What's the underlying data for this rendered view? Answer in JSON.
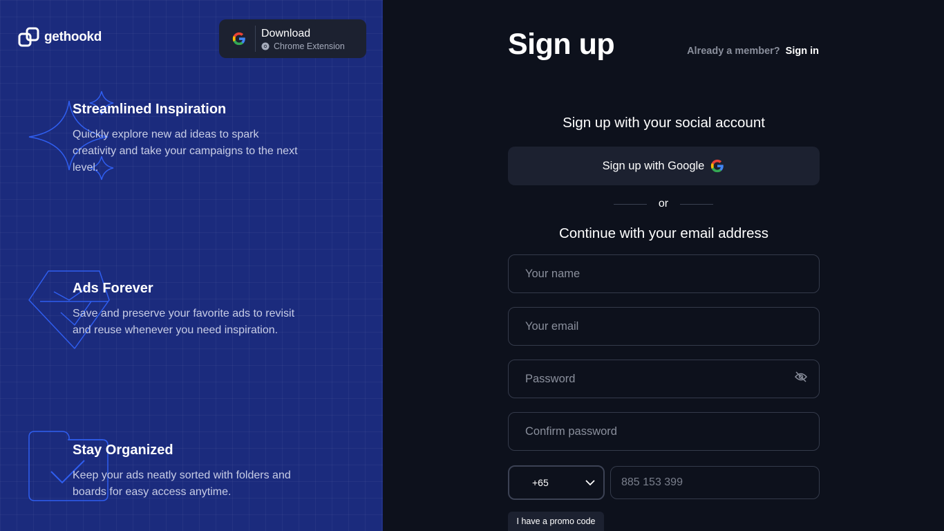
{
  "brand": {
    "name": "gethookd"
  },
  "download": {
    "title": "Download",
    "subtitle": "Chrome Extension"
  },
  "features": [
    {
      "title": "Streamlined Inspiration",
      "text": "Quickly explore new ad ideas to spark creativity and take your campaigns to the next level.",
      "icon": "sparkle-icon"
    },
    {
      "title": "Ads Forever",
      "text": "Save and preserve your favorite ads to revisit and reuse whenever you need inspiration.",
      "icon": "bookmark-badge-icon"
    },
    {
      "title": "Stay Organized",
      "text": "Keep your ads neatly sorted with folders and boards for easy access anytime.",
      "icon": "folder-check-icon"
    }
  ],
  "signup": {
    "title": "Sign up",
    "member_question": "Already a member?",
    "sign_in": "Sign in",
    "social_heading": "Sign up with your social account",
    "google_button": "Sign up with Google",
    "or": "or",
    "email_heading": "Continue with your email address",
    "name_placeholder": "Your name",
    "email_placeholder": "Your email",
    "password_placeholder": "Password",
    "confirm_placeholder": "Confirm password",
    "country_code": "+65",
    "phone_placeholder": "885 153 399",
    "promo": "I have a promo code"
  },
  "colors": {
    "left_panel": "#1b2b7d",
    "right_panel": "#0d111c",
    "button_bg": "#1c2130",
    "decor_outline": "#2f5ef0"
  }
}
